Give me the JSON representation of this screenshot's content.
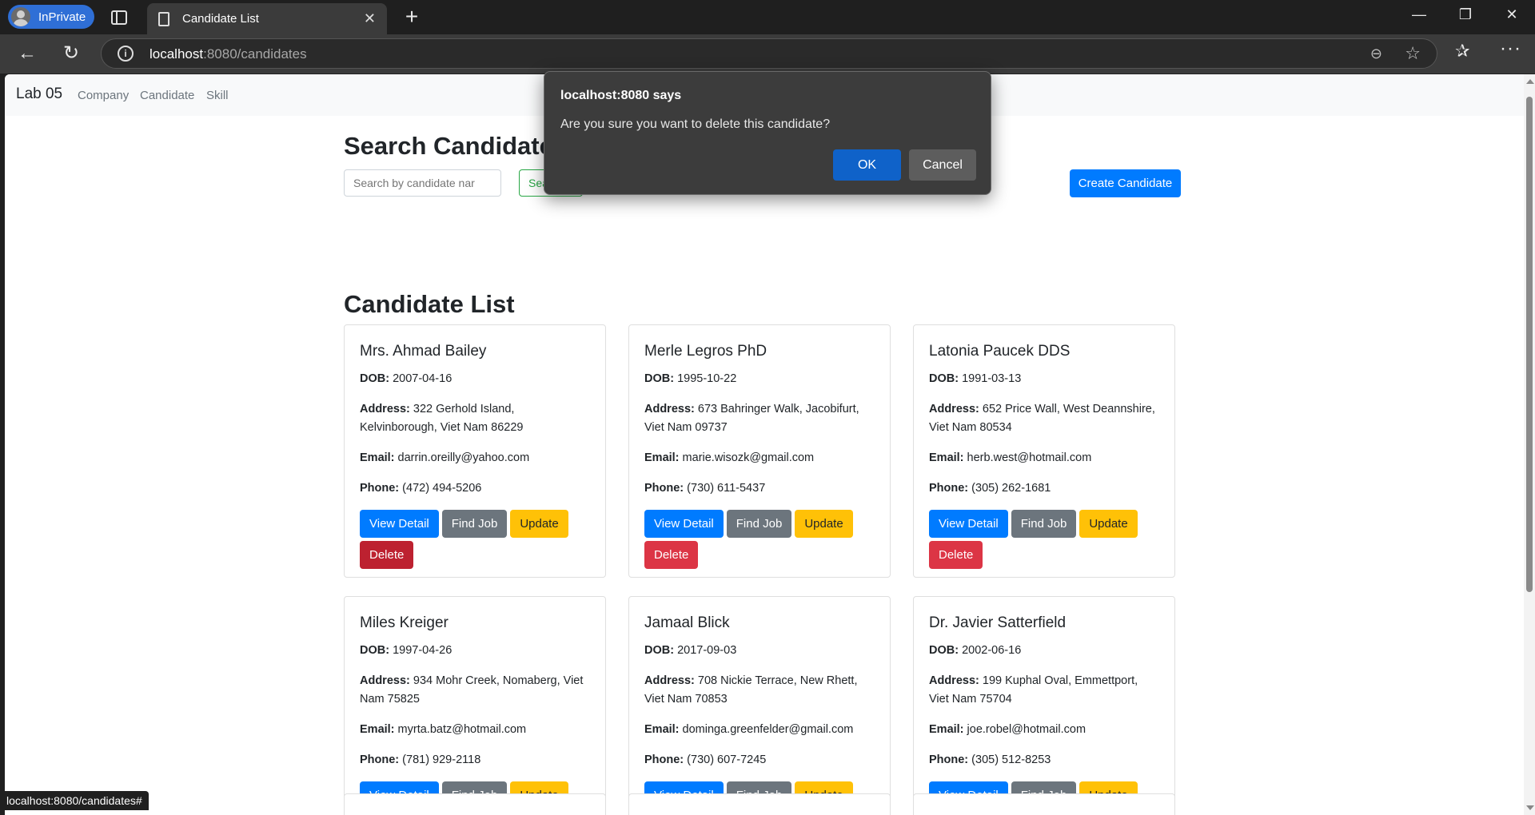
{
  "browser": {
    "inprivate_label": "InPrivate",
    "tab_title": "Candidate List",
    "url_host": "localhost",
    "url_path": ":8080/candidates",
    "status_link": "localhost:8080/candidates#"
  },
  "navbar": {
    "brand": "Lab 05",
    "links": [
      "Company",
      "Candidate",
      "Skill"
    ]
  },
  "search": {
    "title": "Search Candidate",
    "placeholder": "Search by candidate nar",
    "button_label": "Search",
    "create_label": "Create Candidate"
  },
  "list": {
    "title": "Candidate List",
    "labels": {
      "dob": "DOB:",
      "address": "Address:",
      "email": "Email:",
      "phone": "Phone:"
    },
    "buttons": {
      "view": "View Detail",
      "find": "Find Job",
      "update": "Update",
      "delete": "Delete"
    },
    "candidates": [
      {
        "name": "Mrs. Ahmad Bailey",
        "dob": "2007-04-16",
        "address": "322 Gerhold Island, Kelvinborough, Viet Nam 86229",
        "email": "darrin.oreilly@yahoo.com",
        "phone": "(472) 494-5206"
      },
      {
        "name": "Merle Legros PhD",
        "dob": "1995-10-22",
        "address": "673 Bahringer Walk, Jacobifurt, Viet Nam 09737",
        "email": "marie.wisozk@gmail.com",
        "phone": "(730) 611-5437"
      },
      {
        "name": "Latonia Paucek DDS",
        "dob": "1991-03-13",
        "address": "652 Price Wall, West Deannshire, Viet Nam 80534",
        "email": "herb.west@hotmail.com",
        "phone": "(305) 262-1681"
      },
      {
        "name": "Miles Kreiger",
        "dob": "1997-04-26",
        "address": "934 Mohr Creek, Nomaberg, Viet Nam 75825",
        "email": "myrta.batz@hotmail.com",
        "phone": "(781) 929-2118"
      },
      {
        "name": "Jamaal Blick",
        "dob": "2017-09-03",
        "address": "708 Nickie Terrace, New Rhett, Viet Nam 70853",
        "email": "dominga.greenfelder@gmail.com",
        "phone": "(730) 607-7245"
      },
      {
        "name": "Dr. Javier Satterfield",
        "dob": "2002-06-16",
        "address": "199 Kuphal Oval, Emmettport, Viet Nam 75704",
        "email": "joe.robel@hotmail.com",
        "phone": "(305) 512-8253"
      }
    ]
  },
  "dialog": {
    "title": "localhost:8080 says",
    "message": "Are you sure you want to delete this candidate?",
    "ok_label": "OK",
    "cancel_label": "Cancel"
  },
  "colors": {
    "primary": "#007bff",
    "secondary": "#6c757d",
    "warning": "#ffc107",
    "danger": "#dc3545",
    "success": "#28a745"
  }
}
